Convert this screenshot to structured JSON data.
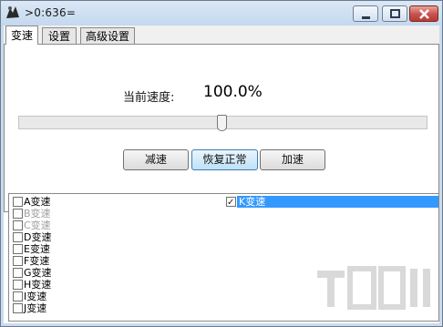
{
  "window": {
    "title": ">0:636="
  },
  "tabs": [
    {
      "label": "变速",
      "active": true
    },
    {
      "label": "设置",
      "active": false
    },
    {
      "label": "高级设置",
      "active": false
    }
  ],
  "speed": {
    "label": "当前速度:",
    "value": "100.0%",
    "slider_level": 0.5
  },
  "buttons": {
    "decrease": "减速",
    "reset": "恢复正常",
    "increase": "加速"
  },
  "hotkeys": [
    {
      "label": "A变速",
      "checked": false,
      "enabled": true
    },
    {
      "label": "B变速",
      "checked": false,
      "enabled": false
    },
    {
      "label": "C变速",
      "checked": false,
      "enabled": false
    },
    {
      "label": "D变速",
      "checked": false,
      "enabled": true
    },
    {
      "label": "E变速",
      "checked": false,
      "enabled": true
    },
    {
      "label": "F变速",
      "checked": false,
      "enabled": true
    },
    {
      "label": "G变速",
      "checked": false,
      "enabled": true
    },
    {
      "label": "H变速",
      "checked": false,
      "enabled": true
    },
    {
      "label": "I变速",
      "checked": false,
      "enabled": true
    },
    {
      "label": "J变速",
      "checked": false,
      "enabled": true
    },
    {
      "label": "K变速",
      "checked": true,
      "enabled": true,
      "selected": true
    }
  ],
  "colors": {
    "selection": "#3399ff",
    "titlebar": "#c9dbee",
    "close_button": "#c75050"
  }
}
